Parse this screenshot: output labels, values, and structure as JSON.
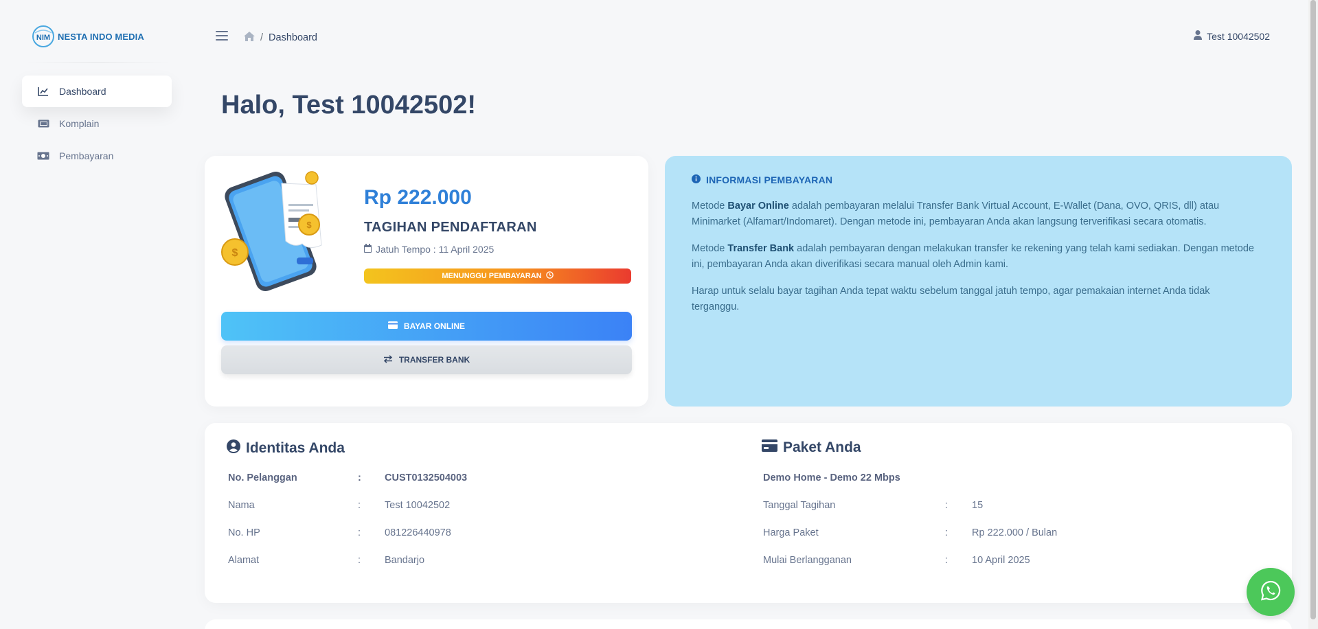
{
  "brand": {
    "name": "NESTA INDO MEDIA",
    "logo_letters": "NIM"
  },
  "sidebar": {
    "items": [
      {
        "label": "Dashboard",
        "icon": "chart-line-icon",
        "active": true
      },
      {
        "label": "Komplain",
        "icon": "ticket-icon",
        "active": false
      },
      {
        "label": "Pembayaran",
        "icon": "money-bill-icon",
        "active": false
      }
    ]
  },
  "header": {
    "breadcrumb_current": "Dashboard",
    "breadcrumb_separator": "/",
    "user_name": "Test 10042502"
  },
  "greeting": "Halo, Test 10042502!",
  "bill": {
    "amount": "Rp 222.000",
    "title": "TAGIHAN PENDAFTARAN",
    "due": "Jatuh Tempo : 11 April 2025",
    "status": "MENUNGGU PEMBAYARAN",
    "pay_online_label": "BAYAR ONLINE",
    "transfer_label": "TRANSFER BANK"
  },
  "info": {
    "title": "INFORMASI PEMBAYARAN",
    "p1_prefix": "Metode ",
    "p1_bold": "Bayar Online",
    "p1_rest": " adalah pembayaran melalui Transfer Bank Virtual Account, E-Wallet (Dana, OVO, QRIS, dll) atau Minimarket (Alfamart/Indomaret). Dengan metode ini, pembayaran Anda akan langsung terverifikasi secara otomatis.",
    "p2_prefix": "Metode ",
    "p2_bold": "Transfer Bank",
    "p2_rest": " adalah pembayaran dengan melakukan transfer ke rekening yang telah kami sediakan. Dengan metode ini, pembayaran Anda akan diverifikasi secara manual oleh Admin kami.",
    "p3": "Harap untuk selalu bayar tagihan Anda tepat waktu sebelum tanggal jatuh tempo, agar pemakaian internet Anda tidak terganggu."
  },
  "identity": {
    "title": "Identitas Anda",
    "colon": ":",
    "rows": [
      {
        "label": "No. Pelanggan",
        "value": "CUST0132504003"
      },
      {
        "label": "Nama",
        "value": "Test 10042502"
      },
      {
        "label": "No. HP",
        "value": "081226440978"
      },
      {
        "label": "Alamat",
        "value": "Bandarjo"
      }
    ]
  },
  "package": {
    "title": "Paket Anda",
    "name": "Demo Home - Demo 22 Mbps",
    "colon": ":",
    "rows": [
      {
        "label": "Tanggal Tagihan",
        "value": "15"
      },
      {
        "label": "Harga Paket",
        "value": "Rp 222.000 / Bulan"
      },
      {
        "label": "Mulai Berlangganan",
        "value": "10 April 2025"
      }
    ]
  },
  "colors": {
    "primary": "#2f80d8",
    "text": "#344767",
    "info_bg": "#b5e3f8",
    "whatsapp": "#4cc85a",
    "status_gradient": [
      "#f3c41e",
      "#ea3b2f"
    ]
  }
}
